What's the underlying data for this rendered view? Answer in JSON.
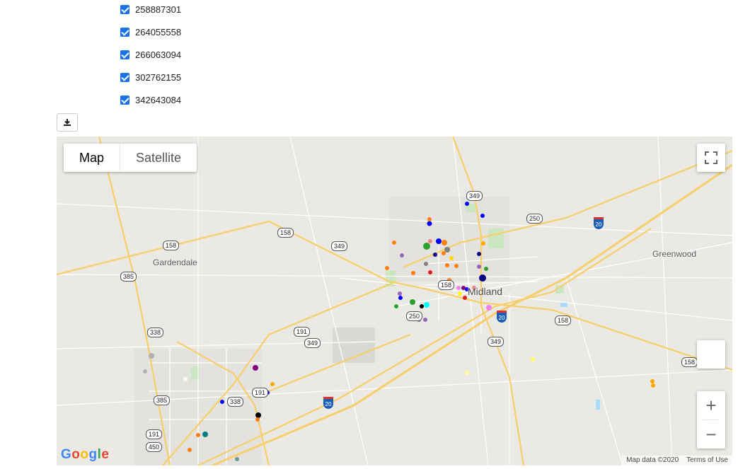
{
  "checkboxes": [
    {
      "label": "258887301",
      "checked": true
    },
    {
      "label": "264055558",
      "checked": true
    },
    {
      "label": "266063094",
      "checked": true
    },
    {
      "label": "302762155",
      "checked": true
    },
    {
      "label": "342643084",
      "checked": true
    }
  ],
  "download": {
    "icon": "download-icon"
  },
  "map": {
    "map_type": {
      "map_label": "Map",
      "satellite_label": "Satellite",
      "selected": "Map"
    },
    "places": {
      "gardendale": "Gardendale",
      "greenwood": "Greenwood",
      "midland": "Midland"
    },
    "highway_shields": [
      "158",
      "158",
      "349",
      "349",
      "250",
      "385",
      "338",
      "191",
      "349",
      "250",
      "158",
      "158",
      "349",
      "338",
      "191",
      "385",
      "191",
      "450",
      "20",
      "20",
      "20"
    ],
    "zoom": {
      "in_label": "+",
      "out_label": "−"
    },
    "attribution": {
      "map_data": "Map data ©2020",
      "terms": "Terms of Use"
    },
    "logo": "Google"
  },
  "colors": {
    "checkbox": "#1a73e8",
    "road": "#f6cf6b",
    "water": "#aadaff",
    "park": "#c9e6c1"
  }
}
